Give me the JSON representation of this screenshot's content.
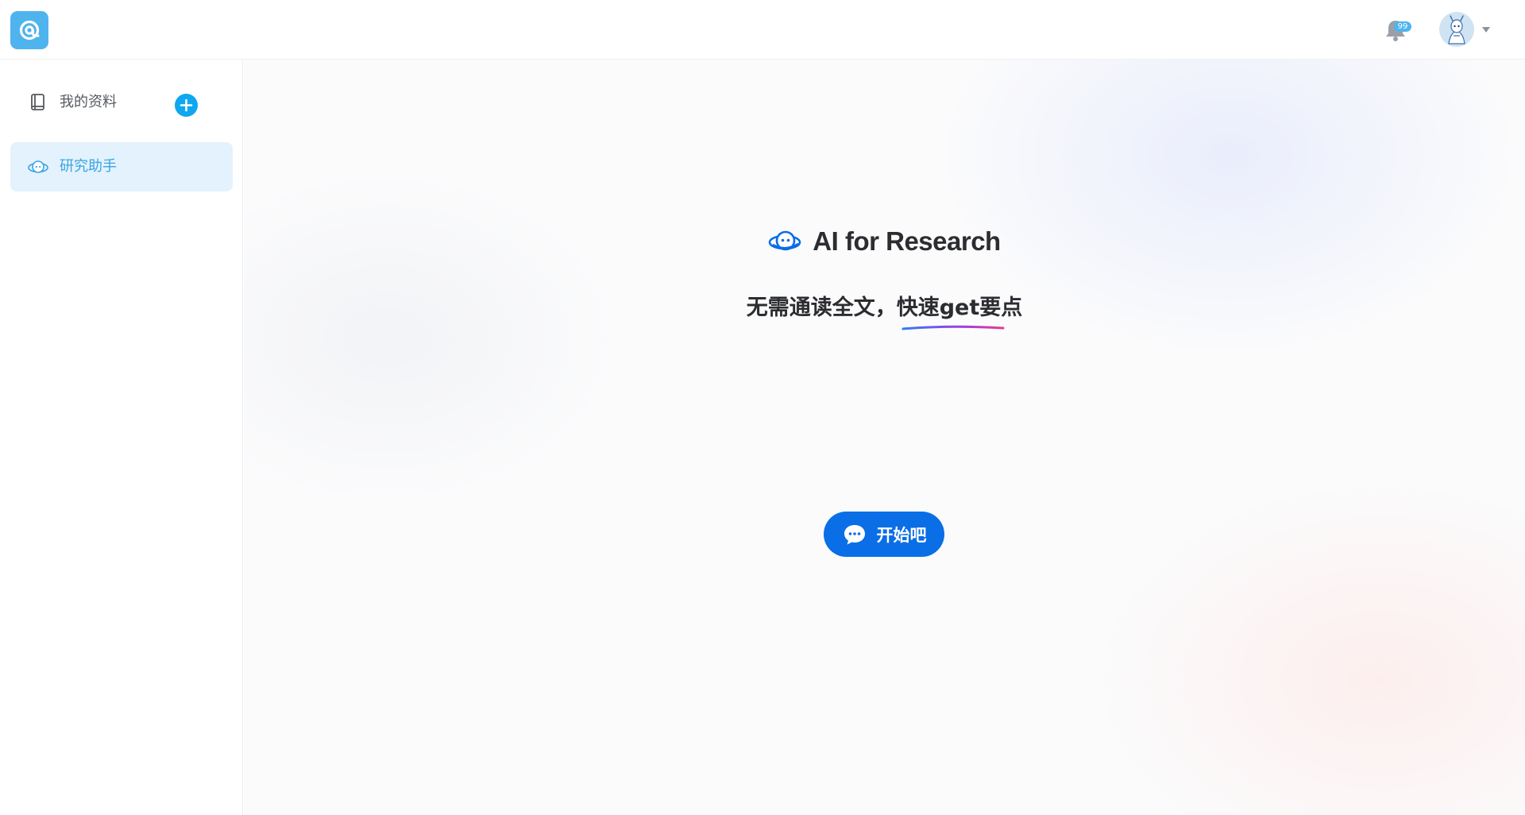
{
  "header": {
    "logo_icon": "at-sign-logo-icon",
    "notification_icon": "bell-icon",
    "notification_count": "99",
    "avatar_icon": "user-avatar",
    "avatar_menu_icon": "caret-down-icon"
  },
  "sidebar": {
    "items": [
      {
        "label": "我的资料",
        "icon": "book-icon",
        "active": false
      },
      {
        "label": "研究助手",
        "icon": "ai-assistant-icon",
        "active": true
      }
    ],
    "add_icon": "plus-icon"
  },
  "main": {
    "title": "AI for Research",
    "title_icon": "ai-assistant-icon",
    "subtitle_prefix": "无需通读全文，",
    "subtitle_highlight": "快速get要点",
    "start_button_label": "开始吧",
    "start_button_icon": "chat-bubble-icon"
  },
  "colors": {
    "brand": "#4fb4ee",
    "active_bg": "#e3f2fc",
    "active_text": "#3aa4e3",
    "primary_button": "#0a6ee6",
    "add_button": "#0ea7f0",
    "underline_gradient": [
      "#2f7df6",
      "#a13de0",
      "#e63d8f"
    ]
  }
}
